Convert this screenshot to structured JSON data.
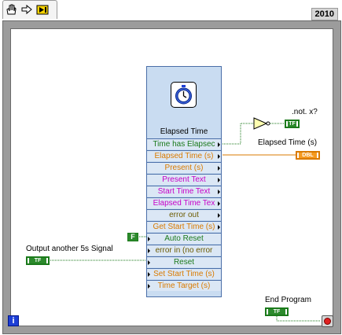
{
  "toolbar": {
    "icons": [
      "hand-icon",
      "arrow-icon",
      "probe-icon"
    ]
  },
  "version_label": "2010",
  "loop": {
    "iteration_terminal": "i"
  },
  "express_vi": {
    "title": "Elapsed Time",
    "terminals": [
      {
        "label": "Time has Elapsec",
        "color": "#1b7a1b",
        "direction": "out"
      },
      {
        "label": "Elapsed Time (s)",
        "color": "#d97a00",
        "direction": "out"
      },
      {
        "label": "Present (s)",
        "color": "#d97a00",
        "direction": "out"
      },
      {
        "label": "Present Text",
        "color": "#c800c8",
        "direction": "out"
      },
      {
        "label": "Start Time Text",
        "color": "#c800c8",
        "direction": "out"
      },
      {
        "label": "Elapsed Time Tex",
        "color": "#c800c8",
        "direction": "out"
      },
      {
        "label": "error out",
        "color": "#6b5a00",
        "direction": "out"
      },
      {
        "label": "Get Start Time (s)",
        "color": "#d97a00",
        "direction": "out"
      },
      {
        "label": "Auto Reset",
        "color": "#1b7a1b",
        "direction": "in"
      },
      {
        "label": "error in (no error",
        "color": "#6b5a00",
        "direction": "in"
      },
      {
        "label": "Reset",
        "color": "#1b7a1b",
        "direction": "in"
      },
      {
        "label": "Set Start Time (s)",
        "color": "#d97a00",
        "direction": "in"
      },
      {
        "label": "Time Target (s)",
        "color": "#d97a00",
        "direction": "in"
      }
    ]
  },
  "not_x_indicator": {
    "label": ".not. x?",
    "type": "TF"
  },
  "elapsed_time_indicator": {
    "label": "Elapsed Time (s)",
    "type": "DBL"
  },
  "auto_reset_constant": {
    "value": "F"
  },
  "output_signal_control": {
    "label": "Output another 5s Signal",
    "type": "TF"
  },
  "end_program_control": {
    "label": "End Program",
    "type": "TF"
  },
  "colors": {
    "boolean_wire": "#1b7a1b",
    "dbl_wire": "#d97a00",
    "loop_frame": "#9c9c9c",
    "vi_body": "#c9dcf1"
  }
}
